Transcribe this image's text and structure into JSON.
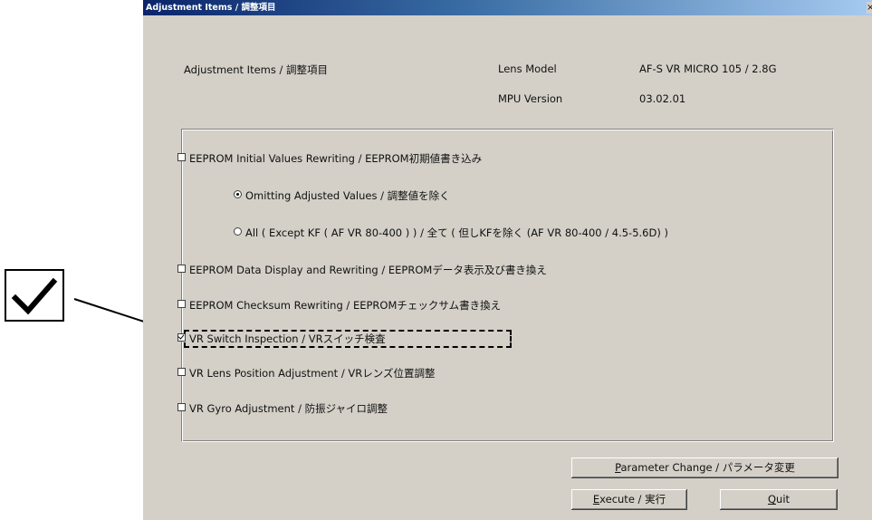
{
  "window": {
    "title": "Adjustment Items / 調整項目",
    "close_label": "×"
  },
  "header": {
    "section_label": "Adjustment Items / 調整項目",
    "lens_model_label": "Lens  Model",
    "lens_model_value": "AF-S VR MICRO 105 / 2.8G",
    "mpu_version_label": "MPU Version",
    "mpu_version_value": "03.02.01"
  },
  "options": [
    {
      "id": "eeprom-initial",
      "label": "EEPROM Initial Values Rewriting / EEPROM初期値書き込み",
      "checked": false
    },
    {
      "id": "eeprom-data",
      "label": "EEPROM Data Display and Rewriting / EEPROMデータ表示及び書き換え",
      "checked": false
    },
    {
      "id": "eeprom-checksum",
      "label": "EEPROM Checksum Rewriting / EEPROMチェックサム書き換え",
      "checked": false
    },
    {
      "id": "vr-switch",
      "label": "VR Switch Inspection / VRスイッチ検査",
      "checked": true
    },
    {
      "id": "vr-lens-position",
      "label": "VR Lens Position Adjustment / VRレンズ位置調整",
      "checked": false
    },
    {
      "id": "vr-gyro",
      "label": "VR Gyro Adjustment / 防振ジャイロ調整",
      "checked": false
    }
  ],
  "radios": [
    {
      "id": "omitting",
      "label": "Omitting Adjusted Values / 調整値を除く",
      "selected": true
    },
    {
      "id": "all",
      "label": "All ( Except KF ( AF VR 80-400 ) ) / 全て ( 但しKFを除く (AF VR 80-400 / 4.5-5.6D) )",
      "selected": false
    }
  ],
  "buttons": {
    "parameter_change_mnemonic": "P",
    "parameter_change_rest": "arameter Change / パラメータ変更",
    "execute_mnemonic": "E",
    "execute_rest": "xecute / 実行",
    "quit_mnemonic": "Q",
    "quit_rest": "uit"
  },
  "icons": {
    "callout_checkbox": "checkmark-icon",
    "callout_arrow": "arrow-icon"
  }
}
